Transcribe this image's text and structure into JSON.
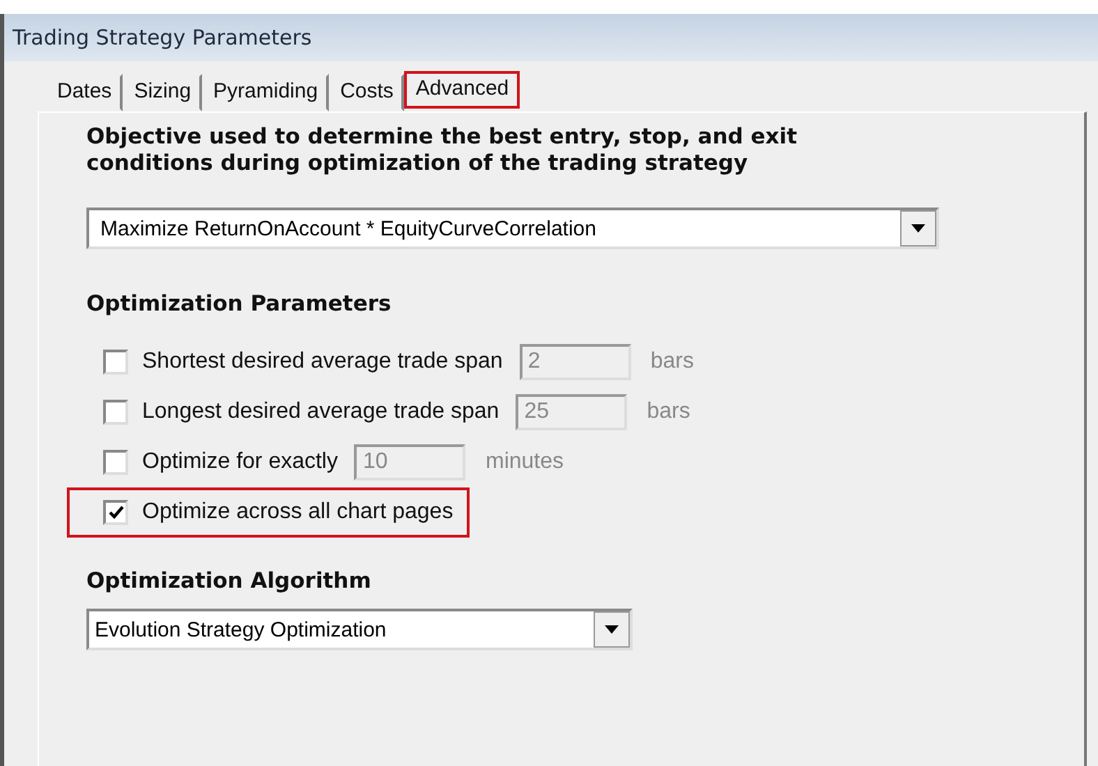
{
  "window": {
    "title": "Trading Strategy Parameters"
  },
  "tabs": [
    {
      "label": "Dates",
      "selected": false,
      "highlighted": false
    },
    {
      "label": "Sizing",
      "selected": false,
      "highlighted": false
    },
    {
      "label": "Pyramiding",
      "selected": false,
      "highlighted": false
    },
    {
      "label": "Costs",
      "selected": false,
      "highlighted": false
    },
    {
      "label": "Advanced",
      "selected": true,
      "highlighted": true
    }
  ],
  "objective": {
    "heading": "Objective used to determine the best entry, stop, and exit conditions during optimization of the trading strategy",
    "value": "Maximize ReturnOnAccount * EquityCurveCorrelation"
  },
  "optimization_parameters": {
    "heading": "Optimization Parameters",
    "options": [
      {
        "label": "Shortest desired average trade span",
        "checked": false,
        "highlighted": false,
        "field": {
          "value": "2",
          "disabled": true
        },
        "unit": "bars"
      },
      {
        "label": "Longest desired average trade span",
        "checked": false,
        "highlighted": false,
        "field": {
          "value": "25",
          "disabled": true
        },
        "unit": "bars"
      },
      {
        "label": "Optimize for exactly",
        "checked": false,
        "highlighted": false,
        "field": {
          "value": "10",
          "disabled": true
        },
        "unit": "minutes"
      },
      {
        "label": "Optimize across all chart pages",
        "checked": true,
        "highlighted": true
      }
    ]
  },
  "algorithm": {
    "heading": "Optimization Algorithm",
    "value": "Evolution Strategy Optimization"
  }
}
